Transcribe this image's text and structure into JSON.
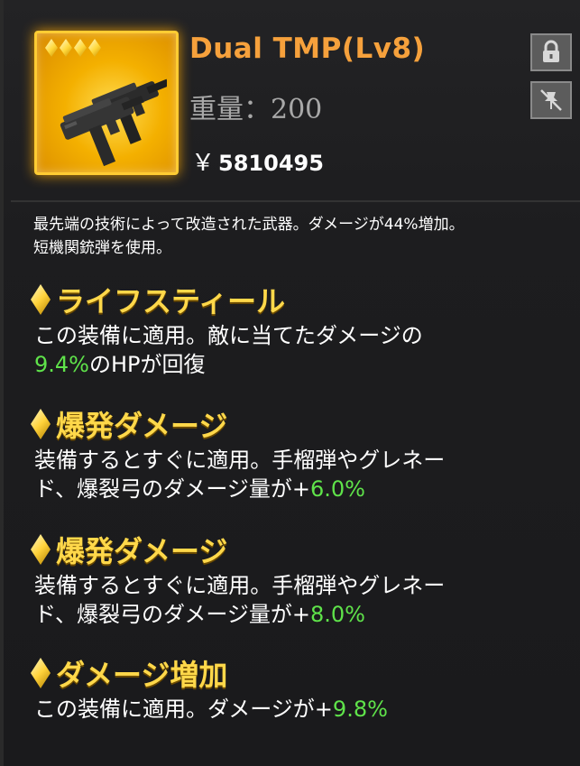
{
  "item": {
    "name": "Dual TMP(Lv8)",
    "weight_label": "重量：200",
    "price_symbol": "￥",
    "price_value": "5810495",
    "star_count": 4,
    "rarity_color": "#ffc400",
    "title_color": "#f6a13c"
  },
  "icons": {
    "lock": "lock-icon",
    "pin": "pin-off-icon",
    "item": "submachine-gun-icon"
  },
  "description": {
    "line1": "最先端の技術によって改造された武器。ダメージが44%増加。",
    "line2": "短機関銃弾を使用。"
  },
  "skills": [
    {
      "name": "ライフスティール",
      "text_line1": "この装備に適用。敵に当てたダメージの",
      "value": "9.4%",
      "suffix": "のHPが回復"
    },
    {
      "name": "爆発ダメージ",
      "text_line1": "装備するとすぐに適用。手榴弾やグレネー",
      "text_line2": "ド、爆裂弓のダメージ量が+",
      "value": "6.0%"
    },
    {
      "name": "爆発ダメージ",
      "text_line1": "装備するとすぐに適用。手榴弾やグレネー",
      "text_line2": "ド、爆裂弓のダメージ量が+",
      "value": "8.0%"
    },
    {
      "name": "ダメージ増加",
      "text_line1": "この装備に適用。ダメージが+",
      "value": "9.8%"
    }
  ]
}
